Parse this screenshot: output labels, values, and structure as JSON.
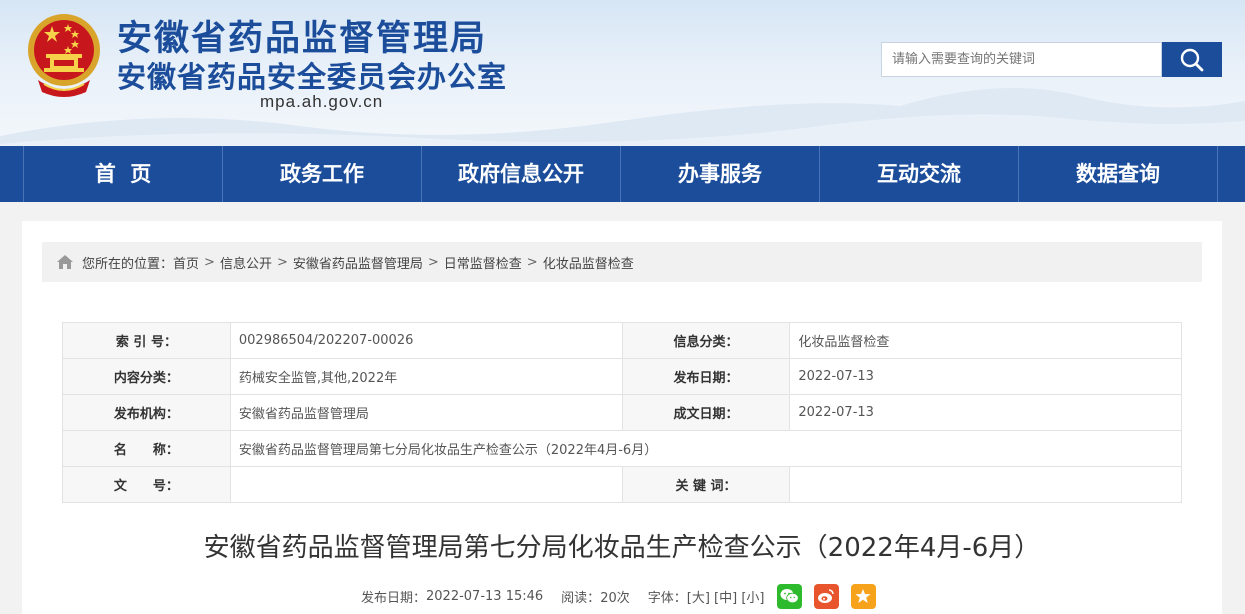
{
  "header": {
    "title_main": "安徽省药品监督管理局",
    "title_sub": "安徽省药品安全委员会办公室",
    "domain": "mpa.ah.gov.cn"
  },
  "search": {
    "placeholder": "请输入需要查询的关键词",
    "button_icon": "search-icon"
  },
  "nav": {
    "items": [
      {
        "label": "首  页"
      },
      {
        "label": "政务工作"
      },
      {
        "label": "政府信息公开"
      },
      {
        "label": "办事服务"
      },
      {
        "label": "互动交流"
      },
      {
        "label": "数据查询"
      }
    ]
  },
  "breadcrumb": {
    "prefix": "您所在的位置：",
    "items": [
      {
        "label": "首页"
      },
      {
        "label": "信息公开"
      },
      {
        "label": "安徽省药品监督管理局"
      },
      {
        "label": "日常监督检查"
      },
      {
        "label": "化妆品监督检查"
      }
    ],
    "separator": ">"
  },
  "info_table": {
    "index_label": "索 引 号：",
    "index_value": "002986504/202207-00026",
    "category_label": "信息分类：",
    "category_value": "化妆品监督检查",
    "content_label": "内容分类：",
    "content_value": "药械安全监管,其他,2022年",
    "pubdate_label": "发布日期：",
    "pubdate_value": "2022-07-13",
    "org_label": "发布机构：",
    "org_value": "安徽省药品监督管理局",
    "created_label": "成文日期：",
    "created_value": "2022-07-13",
    "name_label": "名　　称：",
    "name_value": "安徽省药品监督管理局第七分局化妆品生产检查公示（2022年4月-6月）",
    "docno_label": "文　　号：",
    "docno_value": "",
    "keywords_label": "关 键 词：",
    "keywords_value": ""
  },
  "article": {
    "title": "安徽省药品监督管理局第七分局化妆品生产检查公示（2022年4月-6月）",
    "pub_label": "发布日期：",
    "pub_datetime": "2022-07-13 15:46",
    "views_label": "阅读：",
    "views_value": "20次",
    "font_label": "字体：",
    "font_large": "[大]",
    "font_medium": "[中]",
    "font_small": "[小]"
  },
  "share": {
    "icons": [
      "wechat-icon",
      "weibo-icon",
      "favorite-icon"
    ]
  },
  "colors": {
    "brand_blue": "#1b4d9b",
    "wechat": "#2dbb2d",
    "weibo": "#e8542b",
    "favorite": "#f6a21a"
  }
}
